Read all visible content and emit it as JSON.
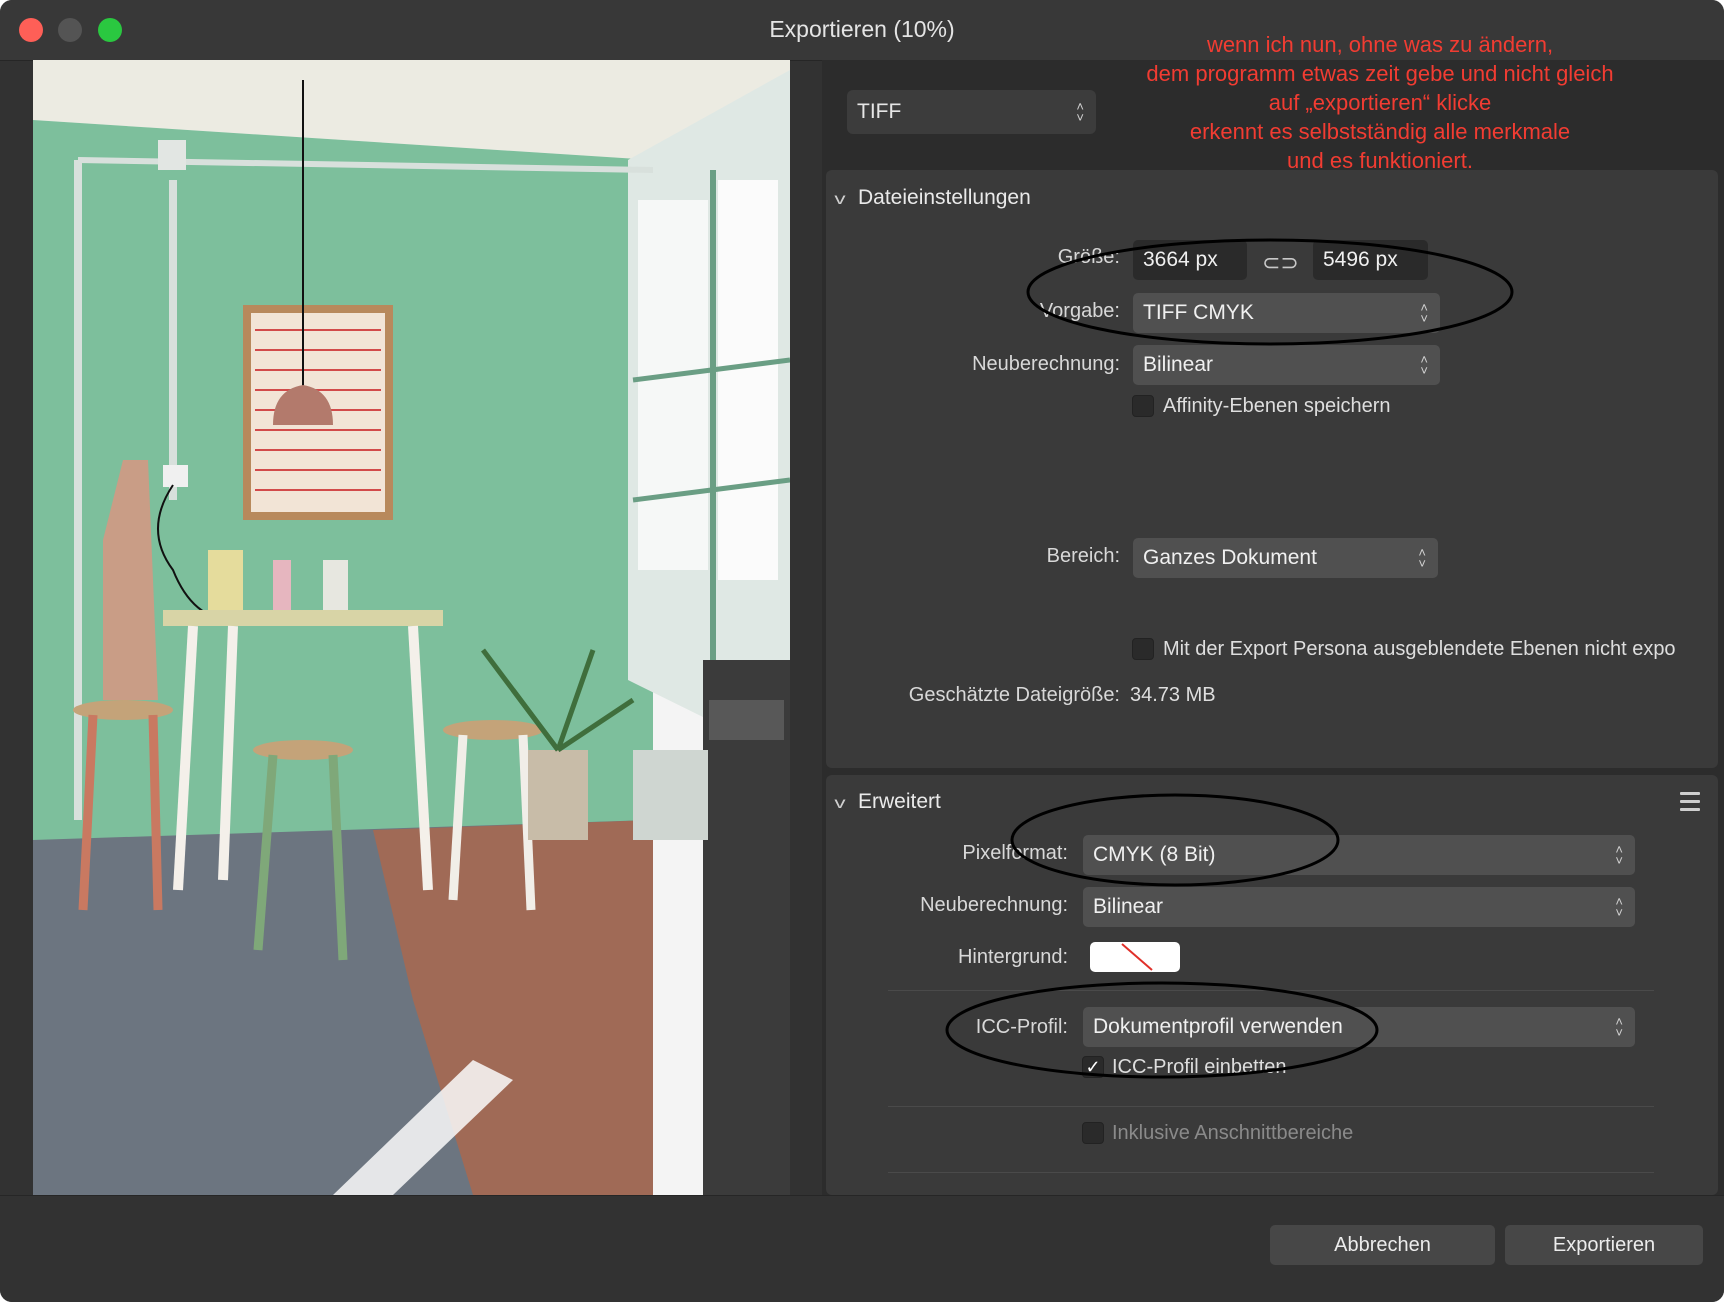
{
  "window": {
    "title": "Exportieren (10%)"
  },
  "annotation": "wenn ich nun, ohne was zu ändern,\ndem programm etwas zeit gebe und nicht gleich\nauf „exportieren“ klicke\nerkennt es selbstständig alle merkmale\nund es funktioniert.",
  "format": {
    "value": "TIFF"
  },
  "file_settings": {
    "header": "Dateieinstellungen",
    "size_label": "Größe:",
    "width_value": "3664 px",
    "height_value": "5496 px",
    "preset_label": "Vorgabe:",
    "preset_value": "TIFF CMYK",
    "resample_label": "Neuberechnung:",
    "resample_value": "Bilinear",
    "save_layers_label": "Affinity-Ebenen speichern",
    "area_label": "Bereich:",
    "area_value": "Ganzes Dokument",
    "hidden_layers_label": "Mit der Export Persona ausgeblendete Ebenen nicht expo",
    "est_size_label": "Geschätzte Dateigröße:",
    "est_size_value": "34.73 MB"
  },
  "advanced": {
    "header": "Erweitert",
    "pixel_format_label": "Pixelformat:",
    "pixel_format_value": "CMYK (8 Bit)",
    "resample_label": "Neuberechnung:",
    "resample_value": "Bilinear",
    "background_label": "Hintergrund:",
    "icc_label": "ICC-Profil:",
    "icc_value": "Dokumentprofil verwenden",
    "embed_icc_label": "ICC-Profil einbetten",
    "embed_icc_checked": true,
    "bleed_label": "Inklusive Anschnittbereiche"
  },
  "buttons": {
    "cancel": "Abbrechen",
    "export": "Exportieren"
  },
  "colors": {
    "annotation": "#f23c32",
    "close": "#fe5f57",
    "maximize": "#2ac840",
    "wall": "#7dbf9c"
  }
}
